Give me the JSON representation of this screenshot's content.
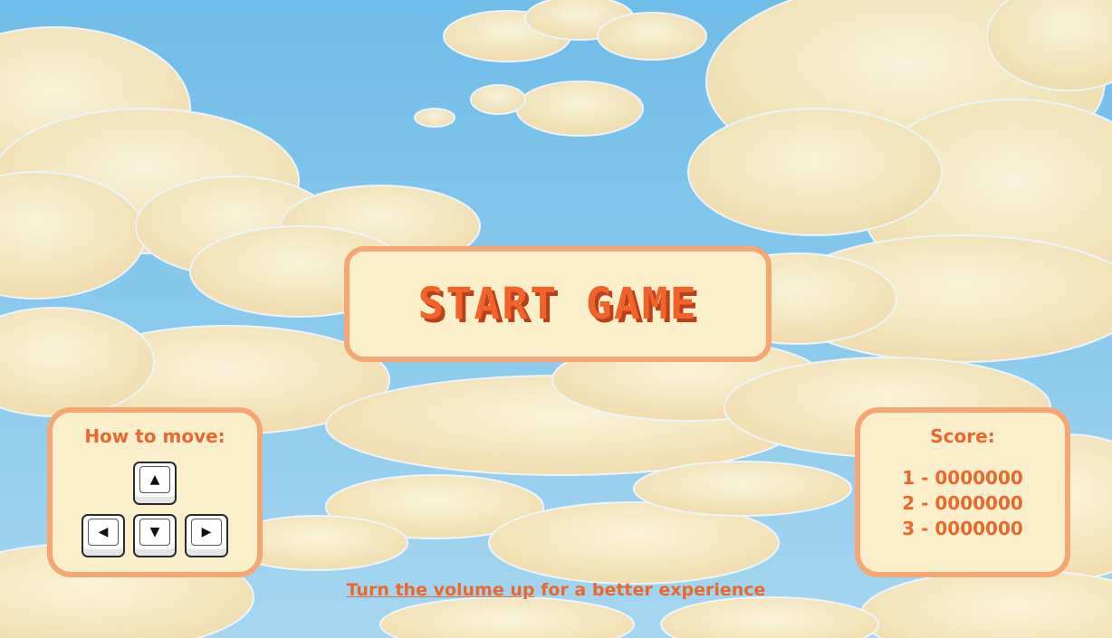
{
  "start_button": {
    "label": "Start Game"
  },
  "controls": {
    "title": "How to move:",
    "keys": {
      "up": "▲",
      "left": "◀",
      "down": "▼",
      "right": "▶"
    }
  },
  "score": {
    "title": "Score:",
    "entries": [
      "1 - 0000000",
      "2 - 0000000",
      "3 - 0000000"
    ]
  },
  "volume_note": {
    "link_text": "Turn the volume up",
    "rest_text": " for a better experience"
  },
  "colors": {
    "sky": "#6fbde9",
    "panel_bg": "#fbeecb",
    "panel_border": "#f4a774",
    "accent": "#e8682d",
    "cloud": "#fbe9bd"
  },
  "icons": [
    "arrow-up-key-icon",
    "arrow-left-key-icon",
    "arrow-down-key-icon",
    "arrow-right-key-icon"
  ]
}
